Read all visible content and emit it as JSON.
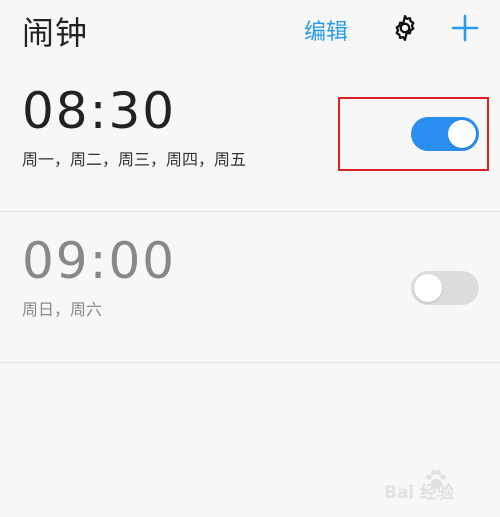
{
  "header": {
    "title": "闹钟",
    "edit_label": "编辑",
    "settings_icon": "gear-icon",
    "add_icon": "plus-icon"
  },
  "alarms": [
    {
      "time": "08:30",
      "days": "周一，周二，周三，周四，周五",
      "enabled": true
    },
    {
      "time": "09:00",
      "days": "周日，周六",
      "enabled": false
    }
  ],
  "colors": {
    "accent": "#2a8ef0",
    "link": "#2a9be8",
    "toggle_off": "#dcdcdc",
    "highlight": "#e02020"
  },
  "watermark": {
    "text": "Bai 经验",
    "icon": "paw-logo-icon"
  }
}
